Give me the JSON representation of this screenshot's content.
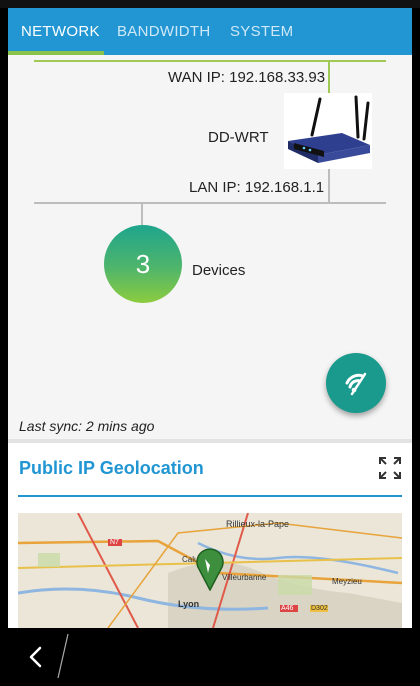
{
  "tabs": [
    "NETWORK",
    "BANDWIDTH",
    "SYSTEM"
  ],
  "active_tab": "NETWORK",
  "network": {
    "wan_ip": "WAN IP: 192.168.33.93",
    "router_name": "DD-WRT",
    "lan_ip": "LAN IP: 192.168.1.1",
    "device_count": "3",
    "devices_label": "Devices",
    "last_sync": "Last sync: 2 mins ago"
  },
  "geolocation": {
    "title": "Public IP Geolocation",
    "map_labels": [
      "Rillieux-la-Pape",
      "Caluire",
      "Villeurbanne",
      "Meyzieu",
      "Lyon",
      "N7",
      "A46",
      "D302"
    ]
  },
  "icons": {
    "fab": "wifi-refresh-icon",
    "expand": "fullscreen-icon",
    "back": "back-icon",
    "pin": "map-pin-icon"
  },
  "colors": {
    "accent": "#2196d3",
    "indicator": "#8bc34a",
    "fab": "#1a9a8c"
  }
}
